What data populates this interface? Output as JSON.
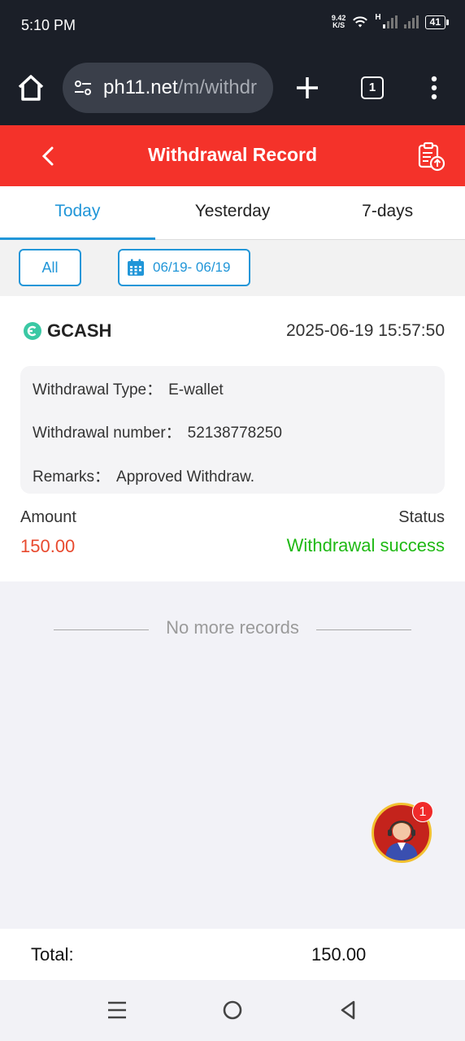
{
  "status_bar": {
    "time": "5:10 PM",
    "net_speed_value": "9.42",
    "net_speed_unit": "K/S",
    "network_type": "H",
    "battery": "41"
  },
  "browser": {
    "url_host": "ph11.net",
    "url_path": "/m/withdr",
    "tab_count": "1",
    "icons": [
      "home-icon",
      "site-settings-icon",
      "plus-icon",
      "tab-switcher-icon",
      "more-vert-icon"
    ]
  },
  "header": {
    "title": "Withdrawal Record",
    "accent": "#f4322a"
  },
  "tabs": [
    {
      "label": "Today",
      "active": true
    },
    {
      "label": "Yesterday",
      "active": false
    },
    {
      "label": "7-days",
      "active": false
    }
  ],
  "filters": {
    "all_label": "All",
    "date_range": "06/19- 06/19"
  },
  "record": {
    "method": "GCASH",
    "datetime": "2025-06-19 15:57:50",
    "type_label": "Withdrawal Type：",
    "type_value": "E-wallet",
    "number_label": "Withdrawal number：",
    "number_value": "52138778250",
    "remarks_label": "Remarks：",
    "remarks_value": "Approved Withdraw.",
    "amount_label": "Amount",
    "amount_value": "150.00",
    "status_label": "Status",
    "status_value": "Withdrawal success",
    "amount_color": "#e84a2f",
    "status_color": "#1fb914"
  },
  "list_end": "No more records",
  "support": {
    "badge": "1"
  },
  "total": {
    "label": "Total:",
    "value": "150.00"
  },
  "colors": {
    "primary_blue": "#2196d8",
    "header_red": "#f4322a",
    "chrome_dark": "#1b1f28"
  }
}
